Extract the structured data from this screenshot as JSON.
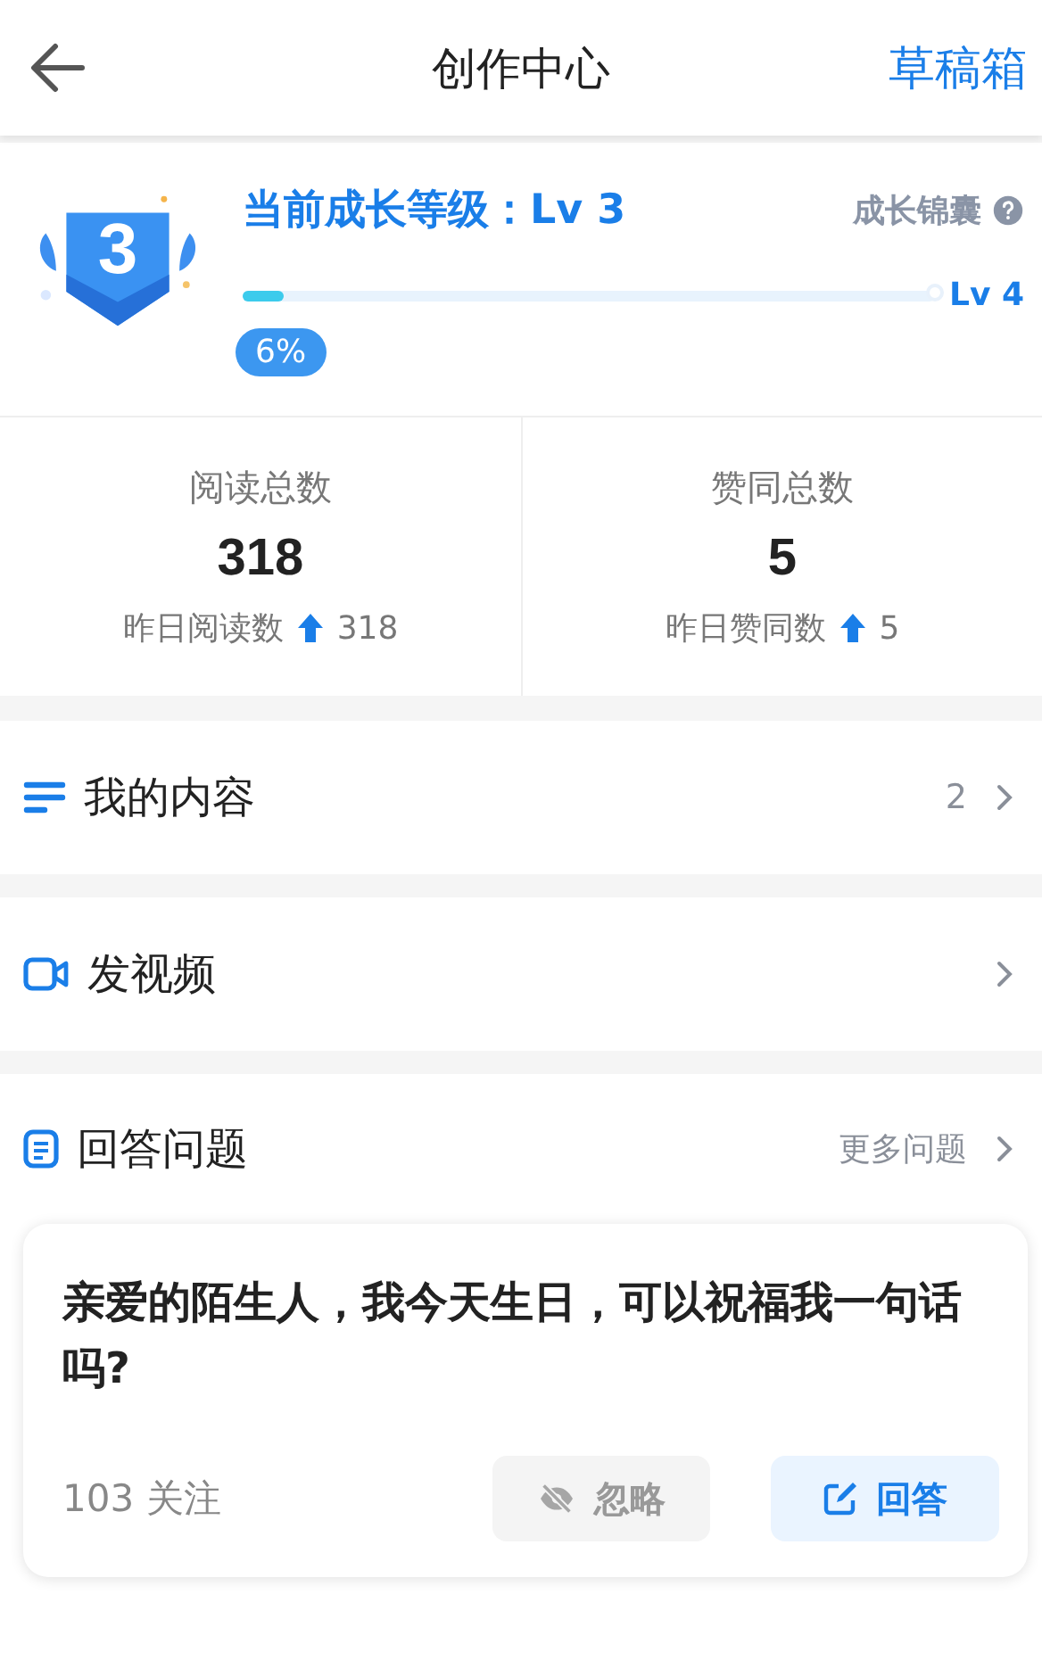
{
  "header": {
    "title": "创作中心",
    "action": "草稿箱"
  },
  "growth": {
    "badge": "3",
    "current": "当前成长等级：Lv 3",
    "tips": "成长锦囊",
    "next": "Lv 4",
    "level": 0.06,
    "percent": "6%"
  },
  "stats": [
    {
      "label": "阅读总数",
      "value": "318",
      "sub_label": "昨日阅读数",
      "sub_value": "318"
    },
    {
      "label": "赞同总数",
      "value": "5",
      "sub_label": "昨日赞同数",
      "sub_value": "5"
    }
  ],
  "menu": [
    {
      "kind": "content",
      "label": "我的内容",
      "count": "2"
    },
    {
      "kind": "video",
      "label": "发视频"
    }
  ],
  "answer": {
    "title": "回答问题",
    "more": "更多问题",
    "question": "亲爱的陌生人，我今天生日，可以祝福我一句话吗?",
    "follows": "103 关注",
    "ignore": "忽略",
    "reply": "回答"
  }
}
